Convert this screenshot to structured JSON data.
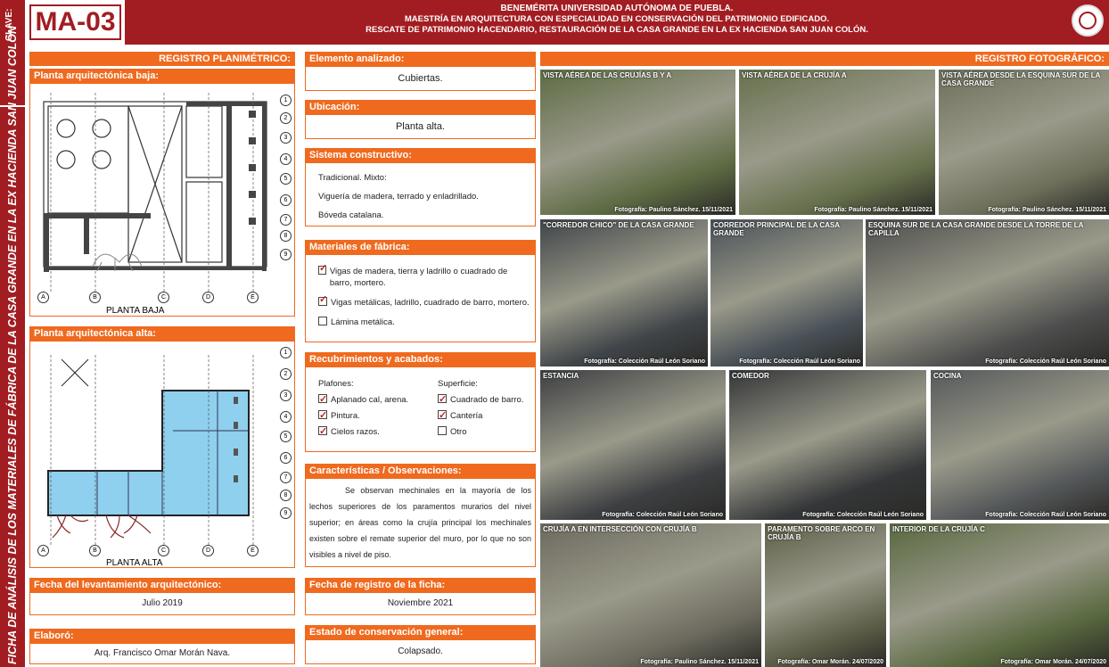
{
  "side": {
    "clave_label": "CLAVE:",
    "title": "FICHA DE ANÁLISIS DE LOS MATERIALES DE FÁBRICA DE LA CASA GRANDE EN LA EX HACIENDA SAN JUAN COLÓN"
  },
  "header": {
    "code": "MA-03",
    "line1": "BENEMÉRITA UNIVERSIDAD AUTÓNOMA DE PUEBLA.",
    "line2": "MAESTRÍA EN ARQUITECTURA CON ESPECIALIDAD EN CONSERVACIÓN DEL PATRIMONIO EDIFICADO.",
    "line3": "RESCATE DE PATRIMONIO HACENDARIO, RESTAURACIÓN DE LA CASA GRANDE EN LA EX HACIENDA SAN JUAN COLÓN."
  },
  "registro_planimetrico": {
    "title": "REGISTRO PLANIMÉTRICO:",
    "planta_baja_title": "Planta arquitectónica baja:",
    "planta_baja_label": "PLANTA BAJA",
    "planta_alta_title": "Planta arquitectónica alta:",
    "planta_alta_label": "PLANTA ALTA",
    "axis_letters": [
      "A",
      "B",
      "C",
      "D",
      "E"
    ],
    "axis_numbers": [
      "1",
      "2",
      "3",
      "4",
      "5",
      "6",
      "7",
      "8",
      "9"
    ]
  },
  "fecha_levantamiento": {
    "title": "Fecha del levantamiento arquitectónico:",
    "value": "Julio 2019"
  },
  "elaboro": {
    "title": "Elaboró:",
    "value": "Arq. Francisco Omar Morán Nava."
  },
  "elemento": {
    "title": "Elemento analizado:",
    "value": "Cubiertas."
  },
  "ubicacion": {
    "title": "Ubicación:",
    "value": "Planta alta."
  },
  "sistema": {
    "title": "Sistema constructivo:",
    "lines": [
      "Tradicional. Mixto:",
      "Viguería de madera, terrado y enladrillado.",
      "Bóveda catalana."
    ]
  },
  "materiales": {
    "title": "Materiales de fábrica:",
    "items": [
      {
        "label": "Vigas de madera, tierra y ladrillo o cuadrado de barro, mortero.",
        "checked": true
      },
      {
        "label": "Vigas metálicas, ladrillo, cuadrado de barro, mortero.",
        "checked": true
      },
      {
        "label": "Lámina metálica.",
        "checked": false
      }
    ]
  },
  "recubrimientos": {
    "title": "Recubrimientos y acabados:",
    "col1_title": "Plafones:",
    "col1": [
      {
        "label": "Aplanado cal, arena.",
        "checked": true
      },
      {
        "label": "Pintura.",
        "checked": true
      },
      {
        "label": "Cielos razos.",
        "checked": true
      }
    ],
    "col2_title": "Superficie:",
    "col2": [
      {
        "label": "Cuadrado de barro.",
        "checked": true
      },
      {
        "label": "Cantería",
        "checked": true
      },
      {
        "label": "Otro",
        "checked": false
      }
    ]
  },
  "caracteristicas": {
    "title": "Características / Observaciones:",
    "text": "Se observan mechinales en la mayoría de los lechos superiores de los paramentos murarios del nivel superior; en áreas como la crujía principal los mechinales existen sobre el remate superior del muro, por lo que no son visibles a nivel de piso."
  },
  "fecha_registro": {
    "title": "Fecha de registro de la ficha:",
    "value": "Noviembre 2021"
  },
  "estado": {
    "title": "Estado de conservación general:",
    "value": "Colapsado."
  },
  "registro_fotografico": {
    "title": "REGISTRO FOTOGRÁFICO:",
    "photos": [
      {
        "caption": "VISTA AÉREA DE LAS CRUJÍAS B Y A",
        "credit": "Fotografía: Paulino Sánchez. 15/11/2021",
        "color": "#5d6b43"
      },
      {
        "caption": "VISTA AÉREA DE LA CRUJÍA A",
        "credit": "Fotografía: Paulino Sánchez. 15/11/2021",
        "color": "#66704c"
      },
      {
        "caption": "VISTA AÉREA DESDE LA ESQUINA SUR DE LA CASA GRANDE",
        "credit": "Fotografía: Paulino Sánchez. 15/11/2021",
        "color": "#6d6f5a"
      },
      {
        "caption": "\"CORREDOR CHICO\" DE LA CASA GRANDE",
        "credit": "Fotografía: Colección Raúl León Soriano",
        "color": "#3f4448"
      },
      {
        "caption": "CORREDOR PRINCIPAL DE LA CASA GRANDE",
        "credit": "Fotografía: Colección Raúl León Soriano",
        "color": "#485057"
      },
      {
        "caption": "ESQUINA SUR DE LA CASA GRANDE DESDE LA TORRE DE LA CAPILLA",
        "credit": "Fotografía: Colección Raúl León Soriano",
        "color": "#4d4d4d"
      },
      {
        "caption": "ESTANCIA",
        "credit": "Fotografía: Colección Raúl León Soriano",
        "color": "#3d3f42"
      },
      {
        "caption": "COMEDOR",
        "credit": "Fotografía: Colección Raúl León Soriano",
        "color": "#343638"
      },
      {
        "caption": "COCINA",
        "credit": "Fotografía: Colección Raúl León Soriano",
        "color": "#55585a"
      },
      {
        "caption": "CRUJÍA A EN INTERSECCIÓN CON CRUJÍA B",
        "credit": "Fotografía: Paulino Sánchez. 15/11/2021",
        "color": "#6c6a5e"
      },
      {
        "caption": "PARAMENTO SOBRE ARCO EN CRUJÍA B",
        "credit": "Fotografía: Omar Morán. 24/07/2020",
        "color": "#5d5e48"
      },
      {
        "caption": "INTERIOR DE LA CRUJÍA C",
        "credit": "Fotografía: Omar Morán. 24/07/2020",
        "color": "#58683f"
      }
    ]
  },
  "colors": {
    "maroon": "#a21d22",
    "orange": "#ef6a1f",
    "plan_fill": "#8fd0ee"
  }
}
